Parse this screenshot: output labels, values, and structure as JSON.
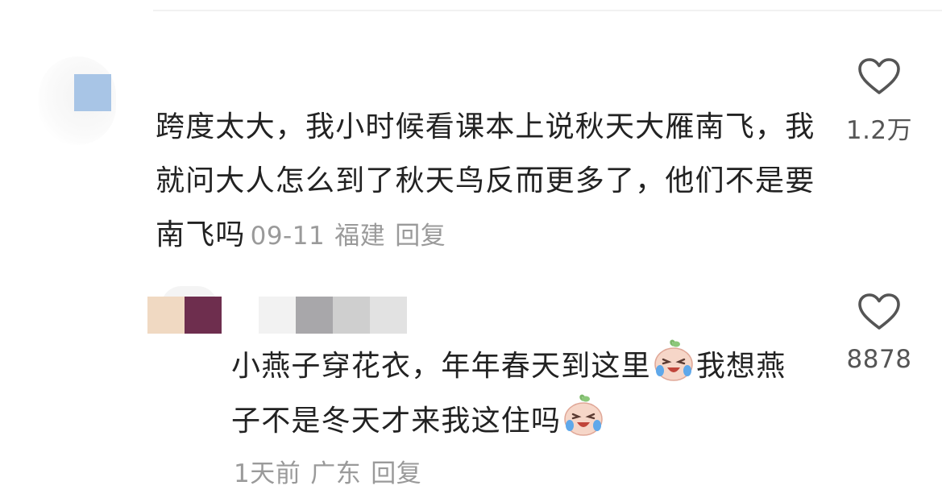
{
  "comments": [
    {
      "text": "跨度太大，我小时候看课本上说秋天大雁南飞，我就问大人怎么到了秋天鸟反而更多了，他们不是要南飞吗",
      "date": "09-11",
      "location": "福建",
      "reply_label": "回复",
      "like_count": "1.2万"
    },
    {
      "text_part1": "小燕子穿花衣，年年春天到这里",
      "text_part2": "我想燕子不是冬天才来我这住吗",
      "emoji_name": "crying-laughing-face-icon",
      "date": "1天前",
      "location": "广东",
      "reply_label": "回复",
      "like_count": "8878"
    }
  ],
  "colors": {
    "text": "#222222",
    "meta": "#9a9a9a",
    "like_count": "#555555",
    "avatar1_placeholder": "#a8c5e6",
    "username2_blocks": [
      "#f0d9c2",
      "#6e2e4e",
      "#f2f2f2",
      "#f0eff2",
      "#a8a7aa",
      "#cfcfcf",
      "#e2e2e2"
    ]
  }
}
